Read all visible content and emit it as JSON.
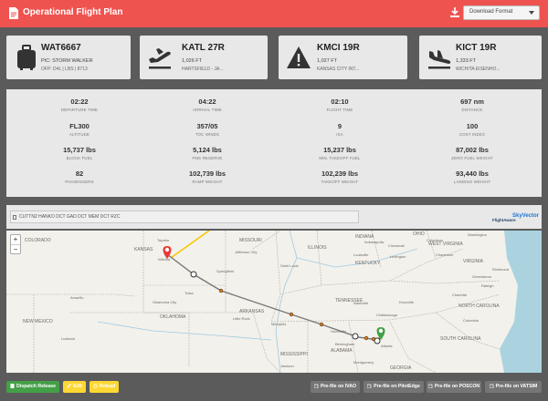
{
  "header": {
    "title": "Operational Flight Plan",
    "download_label": "Download Format",
    "accent": "#ef5350"
  },
  "cards": [
    {
      "code": "WAT6667",
      "line1": "PIC: STORM WALKER",
      "line2": "OFP: D4L | LBS | 8713",
      "icon": "luggage-icon"
    },
    {
      "code": "KATL 27R",
      "line1": "1,026 FT",
      "line2": "HARTSFIELD - JA...",
      "icon": "plane-takeoff-icon"
    },
    {
      "code": "KMCI 19R",
      "line1": "1,027 FT",
      "line2": "KANSAS CITY INT...",
      "icon": "warning-icon"
    },
    {
      "code": "KICT 19R",
      "line1": "1,333 FT",
      "line2": "WICHITA EISENHO...",
      "icon": "plane-landing-icon"
    }
  ],
  "stats": [
    {
      "value": "02:22",
      "label": "DEPARTURE TIME"
    },
    {
      "value": "04:22",
      "label": "ARRIVAL TIME"
    },
    {
      "value": "02:10",
      "label": "FLIGHT TIME"
    },
    {
      "value": "697 nm",
      "label": "DISTANCE"
    },
    {
      "value": "FL300",
      "label": "ALTITUDE"
    },
    {
      "value": "357/05",
      "label": "TOC WINDS"
    },
    {
      "value": "9",
      "label": "ISA"
    },
    {
      "value": "100",
      "label": "COST INDEX"
    },
    {
      "value": "15,737 lbs",
      "label": "BLOCK FUEL"
    },
    {
      "value": "5,124 lbs",
      "label": "FMS RESERVE"
    },
    {
      "value": "15,237 lbs",
      "label": "MIN. TAKEOFF FUEL"
    },
    {
      "value": "87,002 lbs",
      "label": "ZERO FUEL WEIGHT"
    },
    {
      "value": "82",
      "label": "PASSENGERS"
    },
    {
      "value": "102,739 lbs",
      "label": "RAMP WEIGHT"
    },
    {
      "value": "102,239 lbs",
      "label": "TAKEOFF WEIGHT"
    },
    {
      "value": "93,440 lbs",
      "label": "LANDING WEIGHT"
    }
  ],
  "route": {
    "text": "CUTTN2 HANKO DCT GAD DCT MEM DCT RZC",
    "brand_left": "FlightAware",
    "brand_right": "SkyVector"
  },
  "map": {
    "zoom_in": "+",
    "zoom_out": "−",
    "labels": [
      "COLORADO",
      "KANSAS",
      "MISSOURI",
      "ILLINOIS",
      "INDIANA",
      "OHIO",
      "WEST VIRGINIA",
      "VIRGINIA",
      "KENTUCKY",
      "NORTH CAROLINA",
      "TENNESSEE",
      "SOUTH CAROLINA",
      "ARKANSAS",
      "OKLAHOMA",
      "NEW MEXICO",
      "MISSISSIPPI",
      "ALABAMA",
      "GEORGIA",
      "Wichita",
      "Springfield",
      "Tulsa",
      "Nashville",
      "Memphis",
      "Atlanta",
      "Huntsville",
      "Washington",
      "Richmond",
      "Raleigh",
      "Charlotte",
      "Columbia",
      "Louisville",
      "Lexington",
      "Cincinnati",
      "Columbus",
      "Indianapolis",
      "Saint Louis",
      "Oklahoma City",
      "Little Rock",
      "Chattanooga",
      "Birmingham",
      "Knoxville",
      "Topeka",
      "Jefferson City",
      "Charleston",
      "Greensboro",
      "Jackson",
      "Montgomery",
      "Amarillo",
      "Lubbock"
    ]
  },
  "buttons": {
    "dispatch": "Dispatch Release",
    "edit": "Edit",
    "reload": "Reload",
    "ivao": "Pre-file on IVAO",
    "pilotedge": "Pre-file on PilotEdge",
    "poscon": "Pre-file on POSCON",
    "vatsim": "Pre-file on VATSIM"
  }
}
